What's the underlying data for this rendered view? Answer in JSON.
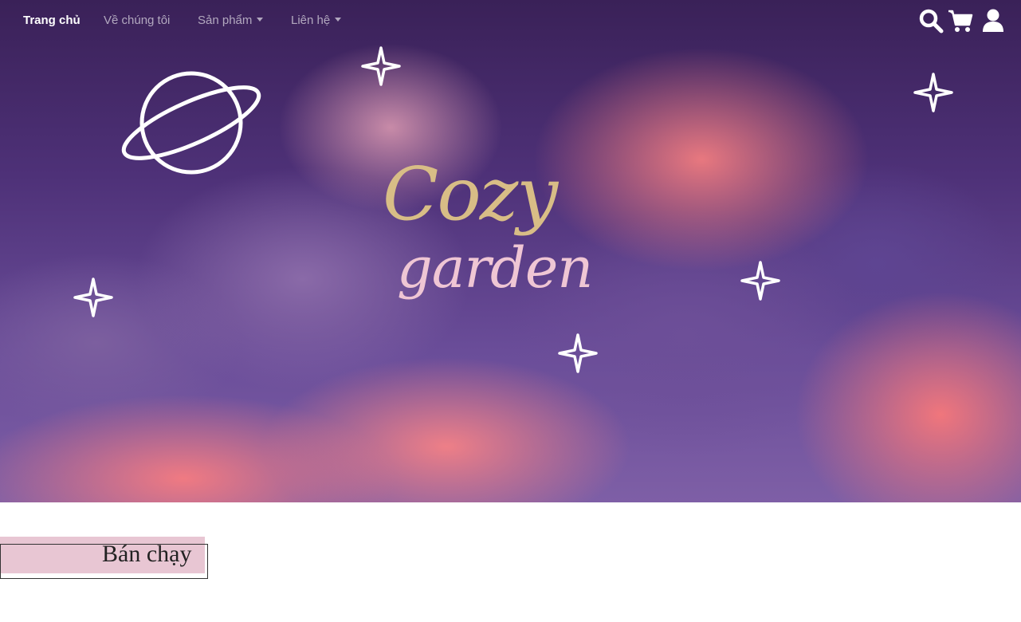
{
  "nav": {
    "items": [
      {
        "label": "Trang chủ",
        "active": true
      },
      {
        "label": "Về chúng tôi"
      },
      {
        "label": "Sản phẩm",
        "dropdown": true
      },
      {
        "label": "Liên hệ",
        "dropdown": true
      }
    ],
    "icons": [
      "search-icon",
      "cart-icon",
      "user-icon"
    ]
  },
  "hero": {
    "logo_line1": "Cozy",
    "logo_line2": "garden",
    "colors": {
      "logo_primary": "#d8bd86",
      "logo_secondary": "#efc6d4"
    }
  },
  "bestseller": {
    "title": "Bán chạy",
    "tag_color": "#e8c6d3"
  }
}
